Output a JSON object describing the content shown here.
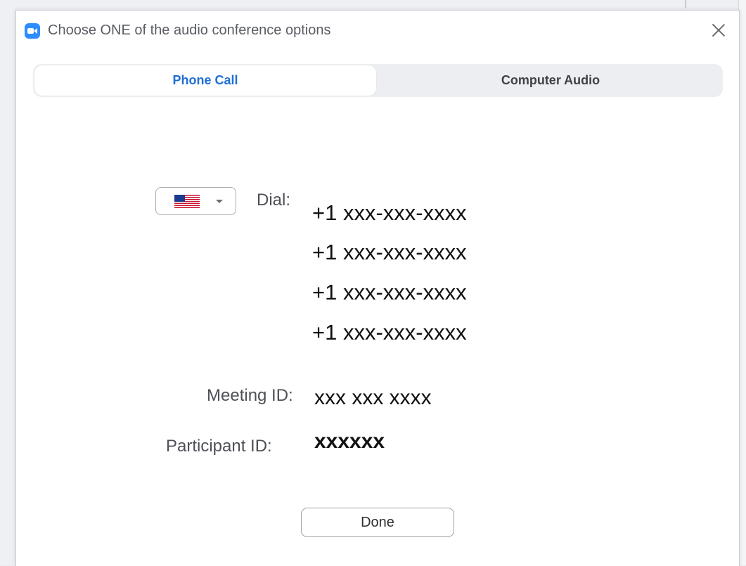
{
  "window": {
    "title": "Choose ONE of the audio conference options",
    "app_icon": "zoom-camera-icon",
    "close_icon": "close-icon"
  },
  "tabs": [
    {
      "label": "Phone Call",
      "active": true
    },
    {
      "label": "Computer Audio",
      "active": false
    }
  ],
  "dial": {
    "country_flag": "us-flag-icon",
    "dropdown_icon": "chevron-down-icon",
    "label": "Dial:",
    "numbers": [
      "+1 xxx-xxx-xxxx",
      "+1 xxx-xxx-xxxx",
      "+1 xxx-xxx-xxxx",
      "+1 xxx-xxx-xxxx"
    ]
  },
  "meeting": {
    "label": "Meeting ID:",
    "value": "xxx xxx xxxx"
  },
  "participant": {
    "label": "Participant ID:",
    "value": "xxxxxx"
  },
  "actions": {
    "done_label": "Done"
  },
  "colors": {
    "accent": "#1f6fd6",
    "zoom_blue": "#2d8cff",
    "tab_background": "#edeef1"
  }
}
